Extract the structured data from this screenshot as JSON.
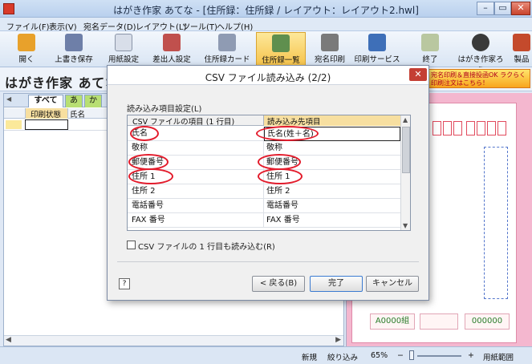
{
  "window": {
    "title": "はがき作家 あてな - [住所録：住所録 / レイアウト：レイアウト2.hwl]",
    "min": "–",
    "max": "▭",
    "close": "✕"
  },
  "menu": [
    "ファイル(F)",
    "表示(V)",
    "宛名データ(D)",
    "レイアウト(L)",
    "ツール(T)",
    "ヘルプ(H)"
  ],
  "toolbar": [
    {
      "label": "開く",
      "icon": "folder-icon",
      "color": "#e8a12b"
    },
    {
      "label": "上書き保存",
      "icon": "floppy-icon",
      "color": "#6e7fa8"
    },
    {
      "label": "用紙設定",
      "icon": "paper-icon",
      "color": "#d8dee9"
    },
    {
      "label": "差出人設定",
      "icon": "person-icon",
      "color": "#c0504d"
    },
    {
      "label": "住所録カード",
      "icon": "card-icon",
      "color": "#8f9bb3"
    },
    {
      "label": "住所録一覧",
      "icon": "list-icon",
      "color": "#5f8f4e"
    },
    {
      "label": "宛名印刷",
      "icon": "printer-icon",
      "color": "#7a7a7a"
    },
    {
      "label": "印刷サービス",
      "icon": "service-icon",
      "color": "#3e6fb8"
    },
    {
      "label": "終了",
      "icon": "exit-icon",
      "color": "#b9c7a0"
    },
    {
      "label": "はがき作家ろう",
      "icon": "mascot-icon",
      "color": "#3a3a3a"
    },
    {
      "label": "製品",
      "icon": "product-icon",
      "color": "#c44a2c"
    }
  ],
  "app_header": {
    "name": "はがき作家 あてな",
    "ad_text": "宛名印刷＆直接投函OK ラクらく印刷注文はこちら！"
  },
  "left_pane": {
    "tabs": [
      "すべて",
      "あ",
      "か"
    ],
    "columns": [
      "印刷状態",
      "氏名"
    ]
  },
  "preview": {
    "stamp1": "A0000組",
    "stamp2": "000000"
  },
  "statusbar": {
    "mode": "新規",
    "filter": "絞り込み",
    "zoom": "65%",
    "zoom_minus": "−",
    "zoom_plus": "+",
    "fit": "用紙範囲"
  },
  "dialog": {
    "title": "CSV ファイル読み込み (2/2)",
    "close": "✕",
    "section_label": "読み込み項目設定(L)",
    "col_source": "CSV ファイルの項目 (1 行目)",
    "col_target": "読み込み先項目",
    "rows": [
      {
        "src": "氏名",
        "dst": "氏名(姓＋名)"
      },
      {
        "src": "敬称",
        "dst": "敬称"
      },
      {
        "src": "郵便番号",
        "dst": "郵便番号"
      },
      {
        "src": "住所 1",
        "dst": "住所 1"
      },
      {
        "src": "住所 2",
        "dst": "住所 2"
      },
      {
        "src": "電話番号",
        "dst": "電話番号"
      },
      {
        "src": "FAX 番号",
        "dst": "FAX 番号"
      }
    ],
    "checkbox_label": "CSV ファイルの 1 行目も読み込む(R)",
    "checkbox_checked": false,
    "help": "?",
    "back": "< 戻る(B)",
    "done": "完了",
    "cancel": "キャンセル"
  }
}
